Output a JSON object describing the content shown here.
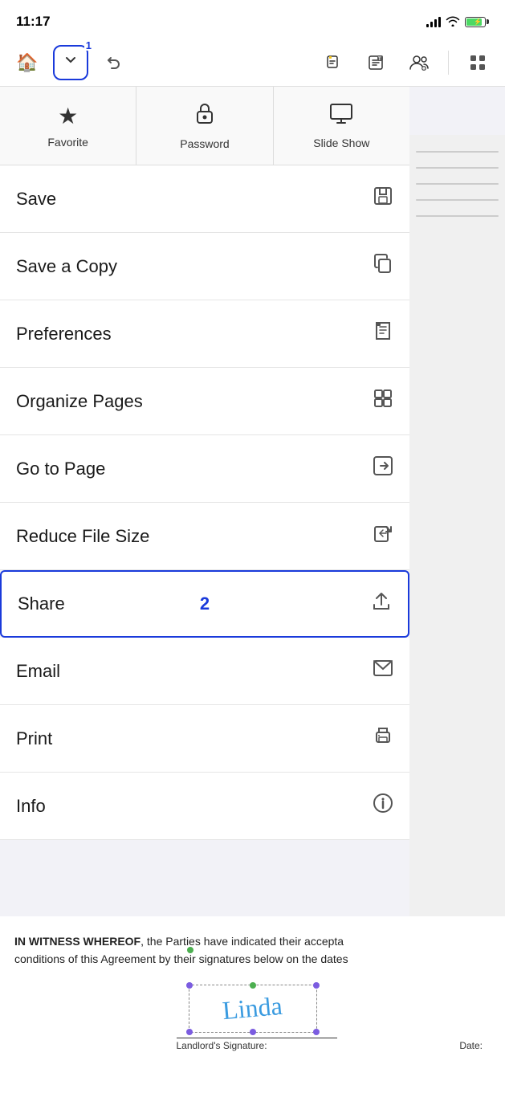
{
  "statusBar": {
    "time": "11:17"
  },
  "toolbar": {
    "homeIcon": "🏠",
    "dropdownBadge": "1",
    "undoIcon": "↩",
    "highlightIcon": "✏️",
    "textIcon": "📝",
    "shareIcon": "👥",
    "appsIcon": "⊞"
  },
  "iconRow": [
    {
      "id": "favorite",
      "label": "Favorite",
      "symbol": "★"
    },
    {
      "id": "password",
      "label": "Password",
      "symbol": "🔒"
    },
    {
      "id": "slideshow",
      "label": "Slide Show",
      "symbol": "🖥"
    }
  ],
  "menuItems": [
    {
      "id": "save",
      "label": "Save",
      "icon": "inbox"
    },
    {
      "id": "save-copy",
      "label": "Save a Copy",
      "icon": "copy"
    },
    {
      "id": "preferences",
      "label": "Preferences",
      "icon": "file"
    },
    {
      "id": "organize-pages",
      "label": "Organize Pages",
      "icon": "grid"
    },
    {
      "id": "go-to-page",
      "label": "Go to Page",
      "icon": "arrow"
    },
    {
      "id": "reduce-file-size",
      "label": "Reduce File Size",
      "icon": "compress"
    },
    {
      "id": "share",
      "label": "Share",
      "badge": "2",
      "icon": "upload",
      "highlighted": true
    },
    {
      "id": "email",
      "label": "Email",
      "icon": "mail"
    },
    {
      "id": "print",
      "label": "Print",
      "icon": "print"
    },
    {
      "id": "info",
      "label": "Info",
      "icon": "info"
    }
  ],
  "docText": {
    "paragraph": "IN WITNESS WHEREOF, the Parties have indicated their accepta conditions of this Agreement by their signatures below on the dates",
    "signatureText": "Linda",
    "landlordLabel": "Landlord's Signature:",
    "dateLabel": "Date:"
  }
}
